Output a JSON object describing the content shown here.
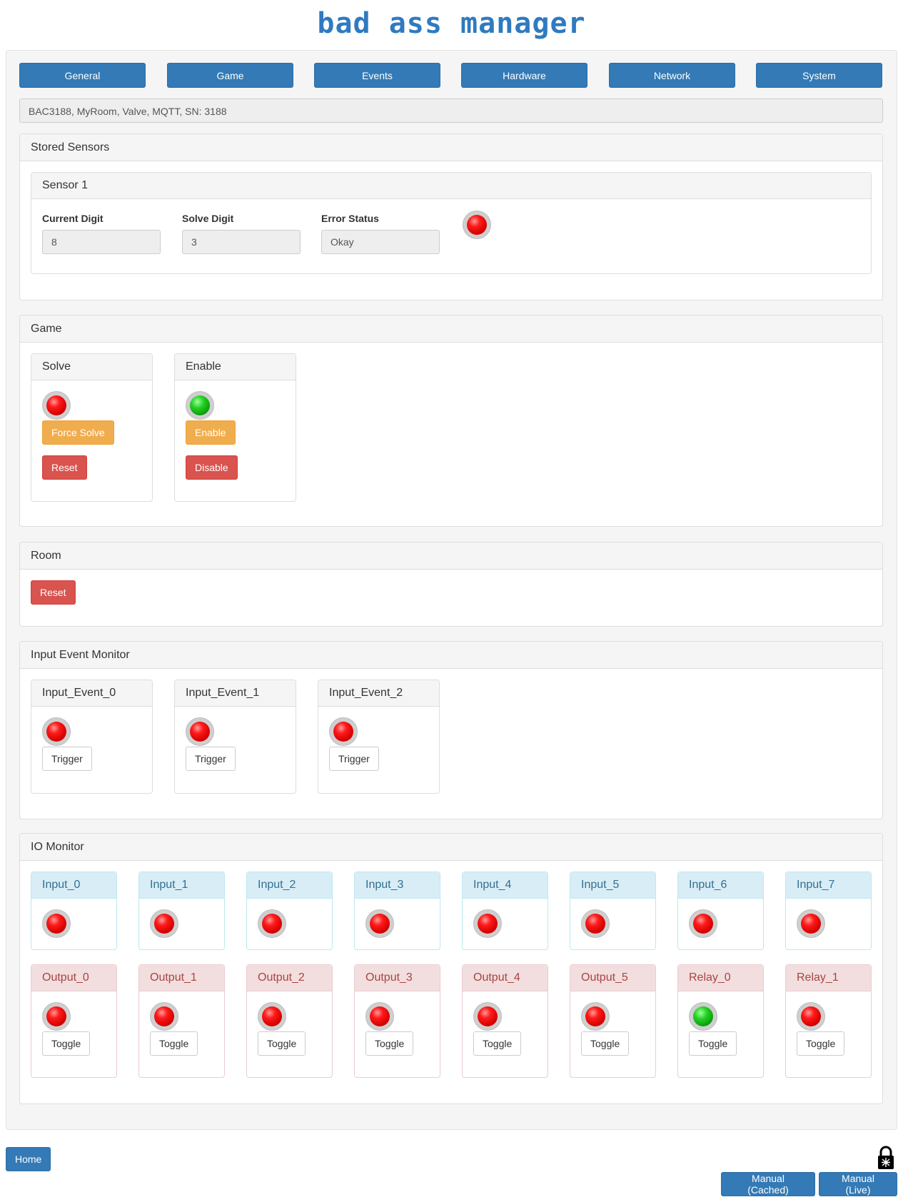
{
  "app": {
    "title": "bad ass manager"
  },
  "nav": {
    "tabs": [
      "General",
      "Game",
      "Events",
      "Hardware",
      "Network",
      "System"
    ]
  },
  "device_info": "BAC3188, MyRoom, Valve, MQTT, SN: 3188",
  "stored_sensors": {
    "title": "Stored Sensors",
    "sensor": {
      "title": "Sensor 1",
      "current_digit_label": "Current Digit",
      "current_digit_value": "8",
      "solve_digit_label": "Solve Digit",
      "solve_digit_value": "3",
      "error_status_label": "Error Status",
      "error_status_value": "Okay",
      "indicator": "red"
    }
  },
  "game": {
    "title": "Game",
    "solve": {
      "title": "Solve",
      "indicator": "red",
      "force_label": "Force Solve",
      "reset_label": "Reset"
    },
    "enable": {
      "title": "Enable",
      "indicator": "green",
      "enable_label": "Enable",
      "disable_label": "Disable"
    }
  },
  "room": {
    "title": "Room",
    "reset_label": "Reset"
  },
  "input_events": {
    "title": "Input Event Monitor",
    "trigger_label": "Trigger",
    "items": [
      {
        "name": "Input_Event_0",
        "indicator": "red"
      },
      {
        "name": "Input_Event_1",
        "indicator": "red"
      },
      {
        "name": "Input_Event_2",
        "indicator": "red"
      }
    ]
  },
  "io_monitor": {
    "title": "IO Monitor",
    "toggle_label": "Toggle",
    "inputs": [
      {
        "name": "Input_0",
        "indicator": "red"
      },
      {
        "name": "Input_1",
        "indicator": "red"
      },
      {
        "name": "Input_2",
        "indicator": "red"
      },
      {
        "name": "Input_3",
        "indicator": "red"
      },
      {
        "name": "Input_4",
        "indicator": "red"
      },
      {
        "name": "Input_5",
        "indicator": "red"
      },
      {
        "name": "Input_6",
        "indicator": "red"
      },
      {
        "name": "Input_7",
        "indicator": "red"
      }
    ],
    "outputs": [
      {
        "name": "Output_0",
        "indicator": "red"
      },
      {
        "name": "Output_1",
        "indicator": "red"
      },
      {
        "name": "Output_2",
        "indicator": "red"
      },
      {
        "name": "Output_3",
        "indicator": "red"
      },
      {
        "name": "Output_4",
        "indicator": "red"
      },
      {
        "name": "Output_5",
        "indicator": "red"
      },
      {
        "name": "Relay_0",
        "indicator": "green"
      },
      {
        "name": "Relay_1",
        "indicator": "red"
      }
    ]
  },
  "footer": {
    "home_label": "Home",
    "manual_cached_label": "Manual (Cached)",
    "manual_live_label": "Manual (Live)",
    "lock_icon": "padlock-icon"
  }
}
